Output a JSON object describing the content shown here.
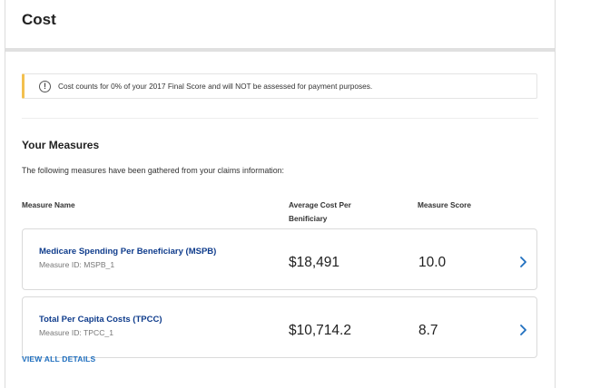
{
  "header": {
    "title": "Cost"
  },
  "alert": {
    "icon": "info-icon",
    "icon_glyph": "!",
    "message": "Cost counts for 0% of your 2017 Final Score and will NOT be assessed for payment purposes.",
    "accent_color": "#f3c04f"
  },
  "measures": {
    "title": "Your Measures",
    "description": "The following measures have been gathered from your claims information:",
    "columns": {
      "name": "Measure Name",
      "cost": "Average Cost Per Benificiary",
      "score": "Measure Score"
    },
    "rows": [
      {
        "name": "Medicare Spending Per Beneficiary (MSPB)",
        "id": "Measure ID: MSPB_1",
        "cost": "$18,491",
        "score": "10.0"
      },
      {
        "name": "Total Per Capita Costs (TPCC)",
        "id": "Measure ID: TPCC_1",
        "cost": "$10,714.2",
        "score": "8.7"
      }
    ],
    "view_all": "VIEW ALL DETAILS"
  },
  "colors": {
    "link": "#1f6fbf",
    "measure_name": "#0f3c8c",
    "chevron": "#1f6fbf"
  }
}
